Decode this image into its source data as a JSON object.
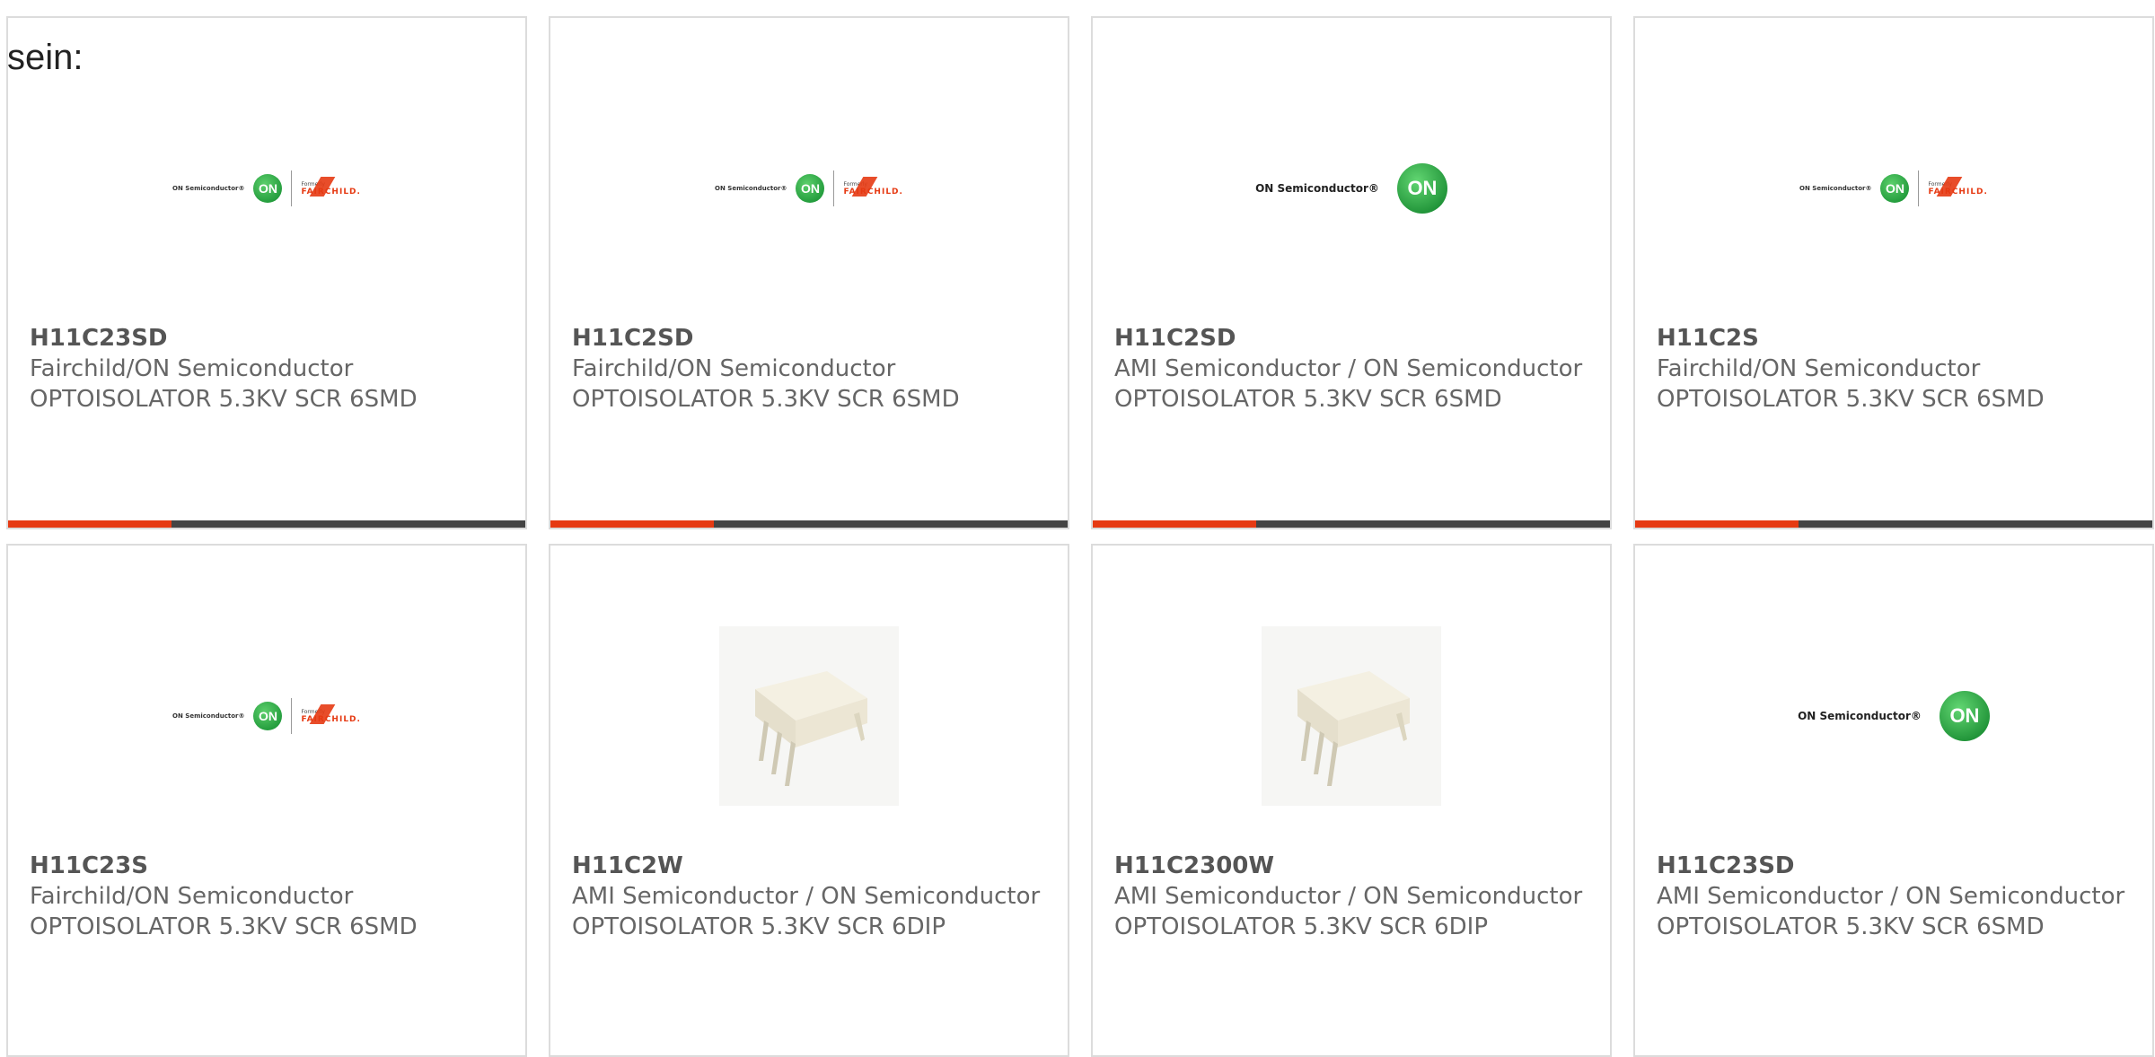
{
  "intro_text": "sein:",
  "products": [
    {
      "part": "H11C23SD",
      "manufacturer": "Fairchild/ON Semiconductor",
      "description": "OPTOISOLATOR 5.3KV SCR 6SMD",
      "image": "on-fairchild-logo",
      "accent": true
    },
    {
      "part": "H11C2SD",
      "manufacturer": "Fairchild/ON Semiconductor",
      "description": "OPTOISOLATOR 5.3KV SCR 6SMD",
      "image": "on-fairchild-logo",
      "accent": true
    },
    {
      "part": "H11C2SD",
      "manufacturer": "AMI Semiconductor / ON Semiconductor",
      "description": "OPTOISOLATOR 5.3KV SCR 6SMD",
      "image": "on-semiconductor-logo",
      "accent": true
    },
    {
      "part": "H11C2S",
      "manufacturer": "Fairchild/ON Semiconductor",
      "description": "OPTOISOLATOR 5.3KV SCR 6SMD",
      "image": "on-fairchild-logo",
      "accent": true
    },
    {
      "part": "H11C23S",
      "manufacturer": "Fairchild/ON Semiconductor",
      "description": "OPTOISOLATOR 5.3KV SCR 6SMD",
      "image": "on-fairchild-logo",
      "accent": false
    },
    {
      "part": "H11C2W",
      "manufacturer": "AMI Semiconductor / ON Semiconductor",
      "description": "OPTOISOLATOR 5.3KV SCR 6DIP",
      "image": "dip-chip-photo",
      "accent": false
    },
    {
      "part": "H11C2300W",
      "manufacturer": "AMI Semiconductor / ON Semiconductor",
      "description": "OPTOISOLATOR 5.3KV SCR 6DIP",
      "image": "dip-chip-photo",
      "accent": false
    },
    {
      "part": "H11C23SD",
      "manufacturer": "AMI Semiconductor / ON Semiconductor",
      "description": "OPTOISOLATOR 5.3KV SCR 6SMD",
      "image": "on-semiconductor-logo",
      "accent": false
    }
  ],
  "logo_text": {
    "on_semiconductor": "ON Semiconductor®",
    "on_badge": "ON",
    "formerly": "Formerly",
    "fairchild": "FAIRCHILD."
  },
  "colors": {
    "accent_red": "#e63a13",
    "accent_dark": "#444444",
    "on_green": "#0f8a2c"
  }
}
